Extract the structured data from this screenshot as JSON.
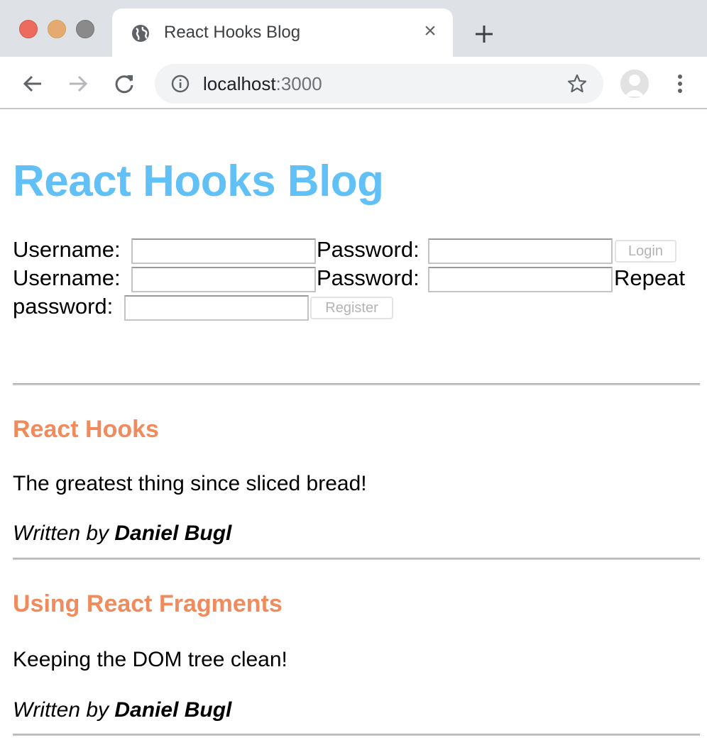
{
  "browser": {
    "tab": {
      "title": "React Hooks Blog",
      "favicon": "globe-icon",
      "close_glyph": "×"
    },
    "url": {
      "host": "localhost",
      "port": ":3000"
    },
    "icons": [
      "back-arrow-icon",
      "forward-arrow-icon",
      "reload-icon",
      "info-icon",
      "star-icon",
      "profile-icon",
      "kebab-menu-icon",
      "new-tab-icon"
    ]
  },
  "page": {
    "title": "React Hooks Blog",
    "login": {
      "username_label": "Username:",
      "password_label": "Password:",
      "username_value": "",
      "password_value": "",
      "submit_label": "Login"
    },
    "register": {
      "username_label": "Username:",
      "password_label": "Password:",
      "repeat_label_1": "Repeat",
      "repeat_label_2": "password:",
      "username_value": "",
      "password_value": "",
      "repeat_value": "",
      "submit_label": "Register"
    },
    "posts": [
      {
        "title": "React Hooks",
        "content": "The greatest thing since sliced bread!",
        "byline_prefix": "Written by ",
        "author": "Daniel Bugl"
      },
      {
        "title": "Using React Fragments",
        "content": "Keeping the DOM tree clean!",
        "byline_prefix": "Written by ",
        "author": "Daniel Bugl"
      }
    ]
  },
  "colors": {
    "title_blue": "#61c1f7",
    "post_title_orange": "#ef8b5c",
    "chrome_bg": "#dee1e6"
  }
}
